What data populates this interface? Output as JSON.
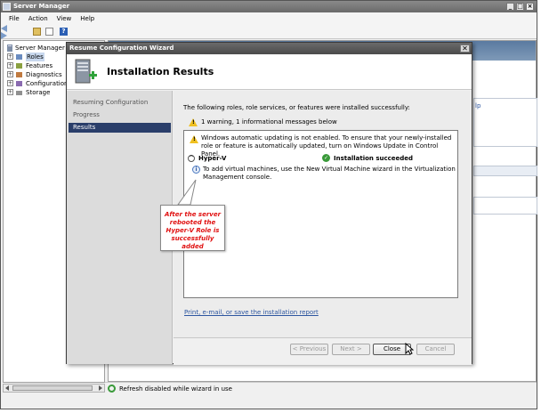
{
  "window": {
    "title": "Server Manager"
  },
  "menu": {
    "items": [
      "File",
      "Action",
      "View",
      "Help"
    ]
  },
  "tree": {
    "root": "Server Manager (W",
    "items": [
      "Roles",
      "Features",
      "Diagnostics",
      "Configuration",
      "Storage"
    ]
  },
  "content": {
    "help_fragment": "lp"
  },
  "status": {
    "text": "Refresh disabled while wizard in use"
  },
  "wizard": {
    "title": "Resume Configuration Wizard",
    "close_label": "✕",
    "heading": "Installation Results",
    "nav": [
      "Resuming Configuration",
      "Progress",
      "Results"
    ],
    "intro": "The following roles, role services, or features were installed successfully:",
    "warning_summary": "1 warning, 1 informational messages below",
    "results": {
      "warning_message": "Windows automatic updating is not enabled. To ensure that your newly-installed role or feature is automatically updated, turn on Windows Update in Control Panel.",
      "role_name": "Hyper-V",
      "status": "Installation succeeded",
      "info_message": "To add virtual machines, use the New Virtual Machine wizard in the Virtualization Management console."
    },
    "callout": "After the server rebooted the Hyper-V Role is successfully added",
    "report_link": "Print, e-mail, or save the installation report",
    "buttons": {
      "previous": "< Previous",
      "next": "Next >",
      "close": "Close",
      "cancel": "Cancel"
    }
  }
}
